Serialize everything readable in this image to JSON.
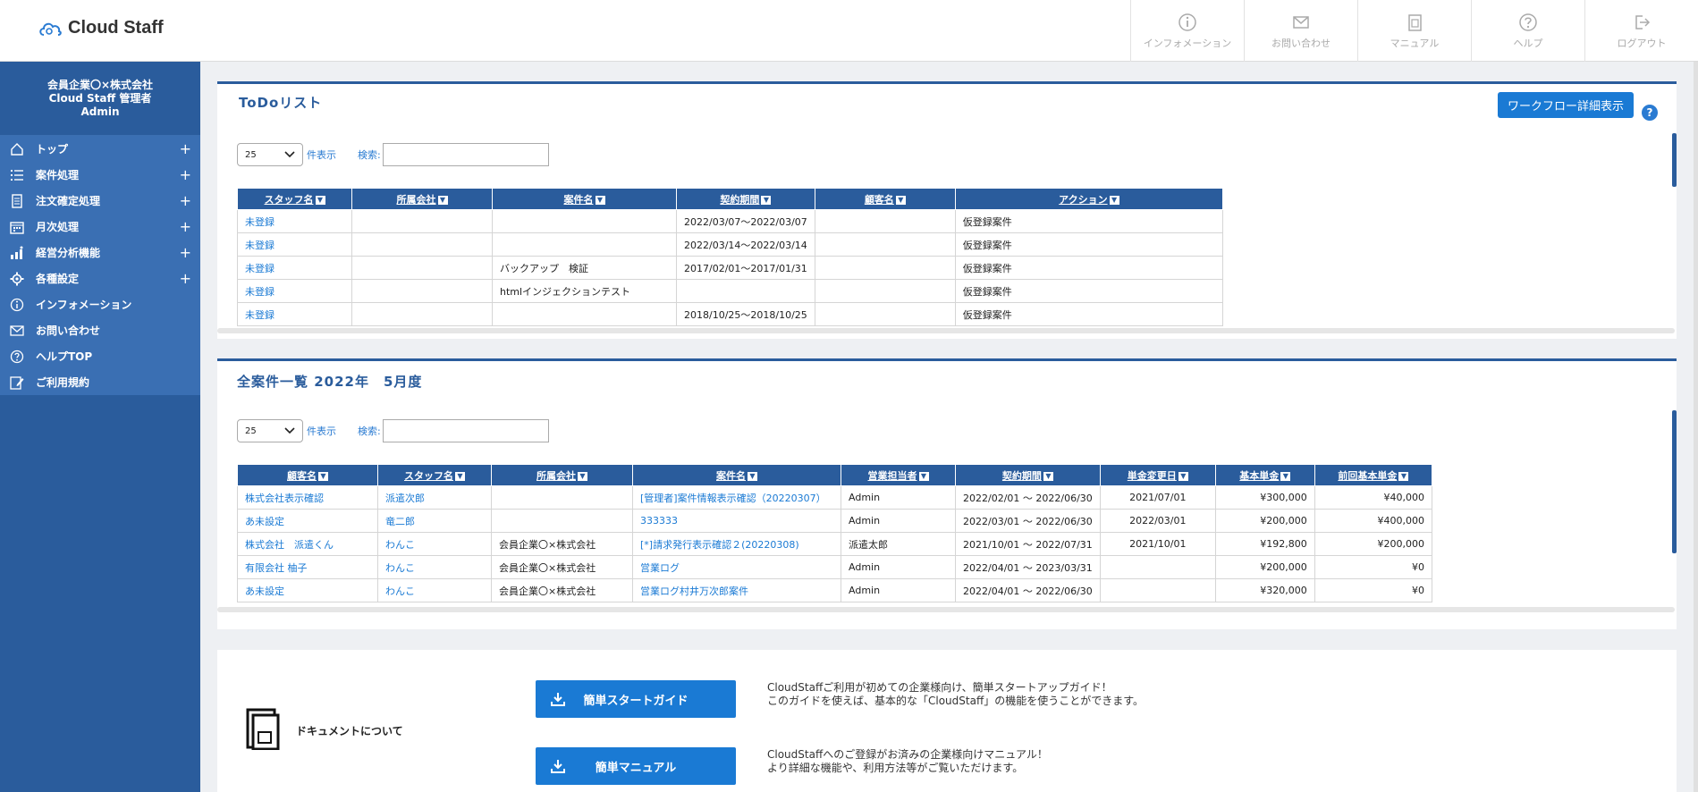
{
  "header": {
    "logo_text": "Cloud Staff",
    "nav": [
      {
        "label": "インフォメーション",
        "icon": "info-icon"
      },
      {
        "label": "お問い合わせ",
        "icon": "mail-icon"
      },
      {
        "label": "マニュアル",
        "icon": "manual-icon"
      },
      {
        "label": "ヘルプ",
        "icon": "help-icon"
      },
      {
        "label": "ログアウト",
        "icon": "logout-icon"
      }
    ]
  },
  "sidebar": {
    "company": "会員企業〇×株式会社",
    "role": "Cloud Staff 管理者",
    "user": "Admin",
    "items": [
      {
        "label": "トップ",
        "icon": "home-icon",
        "expandable": true
      },
      {
        "label": "案件処理",
        "icon": "list-icon",
        "expandable": true
      },
      {
        "label": "注文確定処理",
        "icon": "document-icon",
        "expandable": true
      },
      {
        "label": "月次処理",
        "icon": "calendar-icon",
        "expandable": true
      },
      {
        "label": "経営分析機能",
        "icon": "chart-icon",
        "expandable": true
      },
      {
        "label": "各種設定",
        "icon": "gear-icon",
        "expandable": true
      },
      {
        "label": "インフォメーション",
        "icon": "info-icon",
        "expandable": false
      },
      {
        "label": "お問い合わせ",
        "icon": "mail-icon",
        "expandable": false
      },
      {
        "label": "ヘルプTOP",
        "icon": "help-icon",
        "expandable": false
      },
      {
        "label": "ご利用規約",
        "icon": "terms-icon",
        "expandable": false
      }
    ],
    "plus": "+"
  },
  "todo": {
    "title": "ToDoリスト",
    "workflow_button": "ワークフロー詳細表示",
    "help": "?",
    "page_size": "25",
    "page_size_suffix": "件表示",
    "search_label": "検索:",
    "columns": [
      "スタッフ名",
      "所属会社",
      "案件名",
      "契約期間",
      "顧客名",
      "アクション"
    ],
    "rows": [
      [
        "未登録",
        "",
        "",
        "2022/03/07〜2022/03/07",
        "",
        "仮登録案件"
      ],
      [
        "未登録",
        "",
        "",
        "2022/03/14〜2022/03/14",
        "",
        "仮登録案件"
      ],
      [
        "未登録",
        "",
        "バックアップ　検証",
        "2017/02/01〜2017/01/31",
        "",
        "仮登録案件"
      ],
      [
        "未登録",
        "",
        "htmlインジェクションテスト",
        "",
        "",
        "仮登録案件"
      ],
      [
        "未登録",
        "",
        "",
        "2018/10/25〜2018/10/25",
        "",
        "仮登録案件"
      ]
    ]
  },
  "all_cases": {
    "title": "全案件一覧 2022年　5月度",
    "page_size": "25",
    "page_size_suffix": "件表示",
    "search_label": "検索:",
    "columns": [
      "顧客名",
      "スタッフ名",
      "所属会社",
      "案件名",
      "営業担当者",
      "契約期間",
      "単金変更日",
      "基本単金",
      "前回基本単金"
    ],
    "rows": [
      [
        "株式会社表示確認",
        "派遣次郎",
        "",
        "[管理者]案件情報表示確認（20220307）",
        "Admin",
        "2022/02/01 〜 2022/06/30",
        "2021/07/01",
        "¥300,000",
        "¥40,000"
      ],
      [
        "あ未設定",
        "竜二郎",
        "",
        "333333",
        "Admin",
        "2022/03/01 〜 2022/06/30",
        "2022/03/01",
        "¥200,000",
        "¥400,000"
      ],
      [
        "株式会社　派遣くん",
        "わんこ",
        "会員企業〇×株式会社",
        "[*]請求発行表示確認２(20220308)",
        "派遣太郎",
        "2021/10/01 〜 2022/07/31",
        "2021/10/01",
        "¥192,800",
        "¥200,000"
      ],
      [
        "有限会社 柚子",
        "わんこ",
        "会員企業〇×株式会社",
        "営業ログ",
        "Admin",
        "2022/04/01 〜 2023/03/31",
        "",
        "¥200,000",
        "¥0"
      ],
      [
        "あ未設定",
        "わんこ",
        "会員企業〇×株式会社",
        "営業ログ村井万次郎案件",
        "Admin",
        "2022/04/01 〜 2022/06/30",
        "",
        "¥320,000",
        "¥0"
      ]
    ]
  },
  "documents": {
    "title": "ドキュメントについて",
    "start_guide_button": "簡単スタートガイド",
    "start_guide_desc_1": "CloudStaffご利用が初めての企業様向け、簡単スタートアップガイド！",
    "start_guide_desc_2": "このガイドを使えば、基本的な「CloudStaff」の機能を使うことができます。",
    "manual_button": "簡単マニュアル",
    "manual_desc_1": "CloudStaffへのご登録がお済みの企業様向けマニュアル！",
    "manual_desc_2": "より詳細な機能や、利用方法等がご覧いただけます。"
  },
  "colors": {
    "brand": "#2a5c9c",
    "accent": "#1a7ad4",
    "link": "#1a7ad4"
  }
}
